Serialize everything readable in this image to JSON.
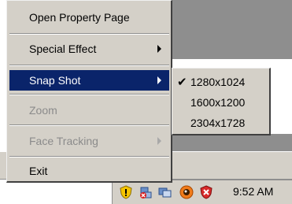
{
  "context_menu": {
    "items": [
      {
        "label": "Open Property Page"
      },
      {
        "label": "Special Effect"
      },
      {
        "label": "Snap Shot"
      },
      {
        "label": "Zoom"
      },
      {
        "label": "Face Tracking"
      },
      {
        "label": "Exit"
      }
    ]
  },
  "snapshot_submenu": {
    "items": [
      {
        "label": "1280x1024",
        "checked": true,
        "check_glyph": "✔"
      },
      {
        "label": "1600x1200",
        "checked": false
      },
      {
        "label": "2304x1728",
        "checked": false
      }
    ]
  },
  "taskbar": {
    "clock": "9:52 AM",
    "tray_icons": [
      "shield-warning-icon",
      "network-error-icon",
      "network-connection-icon",
      "webcam-icon",
      "antivirus-icon"
    ]
  },
  "colors": {
    "menu_bg": "#d4d0c8",
    "highlight": "#0a246a",
    "disabled_text": "#8b8b8b"
  }
}
